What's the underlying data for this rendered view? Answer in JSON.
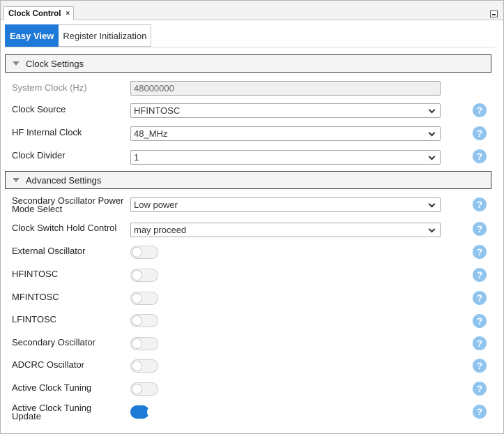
{
  "window": {
    "tab_title": "Clock Control",
    "tab_close": "×"
  },
  "view_tabs": [
    "Easy View",
    "Register Initialization"
  ],
  "active_view_tab": "Easy View",
  "clock_settings": {
    "header": "Clock Settings",
    "system_clock": {
      "label": "System Clock (Hz)",
      "value": "48000000"
    },
    "clock_source": {
      "label": "Clock Source",
      "value": "HFINTOSC"
    },
    "hf_internal_clock": {
      "label": "HF Internal Clock",
      "value": "48_MHz"
    },
    "clock_divider": {
      "label": "Clock Divider",
      "value": "1"
    }
  },
  "advanced_settings": {
    "header": "Advanced Settings",
    "secondary_osc_power": {
      "label_line1": "Secondary Oscillator Power",
      "label_line2": "Mode Select",
      "value": "Low power"
    },
    "clock_switch_hold": {
      "label": "Clock Switch Hold Control",
      "value": "may proceed"
    },
    "toggles": [
      {
        "label": "External Oscillator",
        "on": false
      },
      {
        "label": "HFINTOSC",
        "on": false
      },
      {
        "label": "MFINTOSC",
        "on": false
      },
      {
        "label": "LFINTOSC",
        "on": false
      },
      {
        "label": "Secondary Oscillator",
        "on": false
      },
      {
        "label": "ADCRC Oscillator",
        "on": false
      },
      {
        "label": "Active Clock Tuning",
        "on": false
      }
    ],
    "active_clock_tuning_update": {
      "label_line1": "Active Clock Tuning",
      "label_line2": "Update",
      "on": true
    }
  },
  "help_icon_glyph": "?",
  "colors": {
    "accent": "#1f79d6",
    "help": "#8fc4ef"
  }
}
